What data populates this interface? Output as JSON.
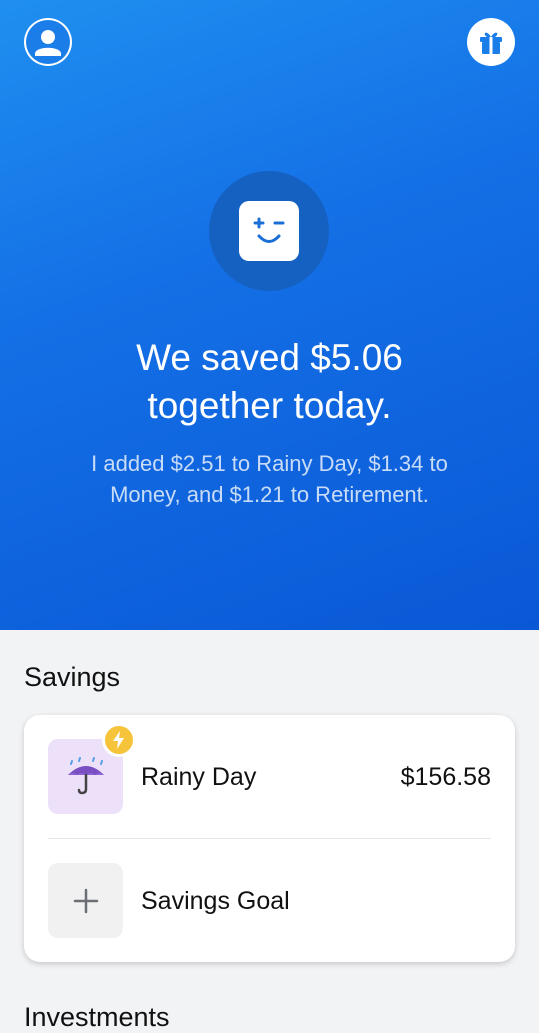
{
  "icons": {
    "profile": "person-icon",
    "gift": "gift-icon",
    "mascot": "winking-face-icon",
    "rainy_day": "umbrella-rain-icon",
    "boost": "lightning-bolt-icon",
    "add": "plus-icon"
  },
  "colors": {
    "hero_gradient_start": "#1f8ff0",
    "hero_gradient_end": "#0a58d6",
    "rainy_tile": "#ece1f8",
    "boost_badge": "#f6c43a"
  },
  "hero": {
    "headline_line1": "We saved $5.06",
    "headline_line2": "together today.",
    "message_line1": "I added $2.51 to Rainy Day, $1.34 to",
    "message_line2": "Money, and $1.21 to Retirement."
  },
  "savings": {
    "title": "Savings",
    "items": [
      {
        "label": "Rainy Day",
        "amount": "$156.58"
      },
      {
        "label": "Savings Goal"
      }
    ]
  },
  "investments": {
    "title": "Investments"
  }
}
